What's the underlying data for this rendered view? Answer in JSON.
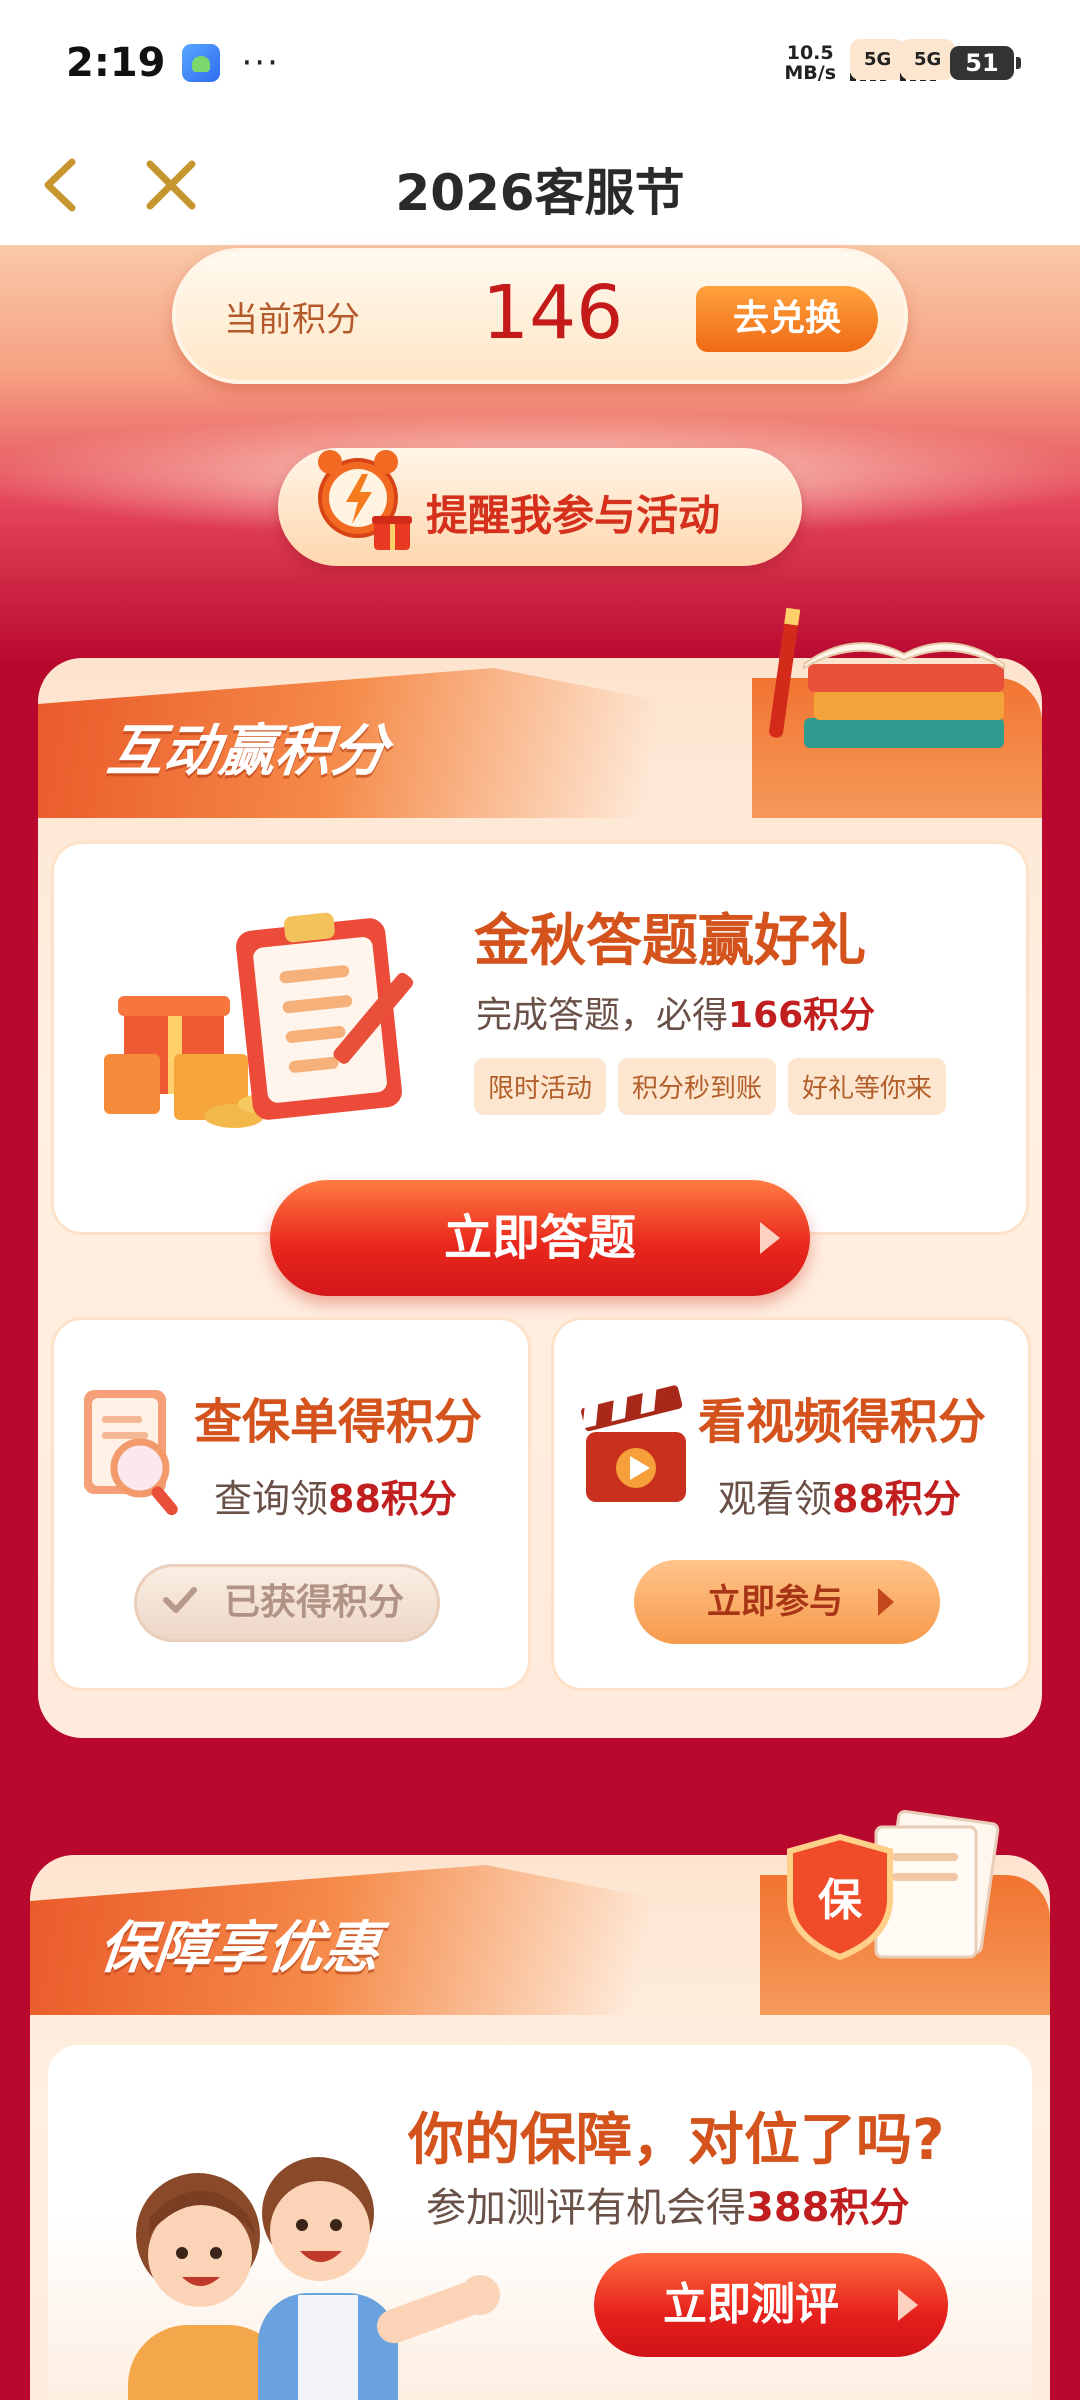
{
  "status_bar": {
    "time": "2:19",
    "more": "···",
    "speed_value": "10.5",
    "speed_unit": "MB/s",
    "network_1": "5G",
    "network_2": "5G",
    "battery": "51"
  },
  "nav": {
    "title": "2026客服节"
  },
  "points": {
    "label": "当前积分",
    "value": "146",
    "exchange_label": "去兑换"
  },
  "remind": {
    "label": "提醒我参与活动"
  },
  "section_interact": {
    "title": "互动赢积分",
    "quiz": {
      "title": "金秋答题赢好礼",
      "desc_prefix": "完成答题，必得",
      "desc_highlight": "166积分",
      "tags": [
        "限时活动",
        "积分秒到账",
        "好礼等你来"
      ],
      "button": "立即答题"
    },
    "policy": {
      "title": "查保单得积分",
      "desc_prefix": "查询领",
      "desc_highlight": "88积分",
      "button": "已获得积分"
    },
    "video": {
      "title": "看视频得积分",
      "desc_prefix": "观看领",
      "desc_highlight": "88积分",
      "button": "立即参与"
    }
  },
  "section_protect": {
    "title": "保障享优惠",
    "shield_text": "保",
    "eval": {
      "title": "你的保障，对位了吗?",
      "desc_prefix": "参加测评有机会得",
      "desc_highlight": "388积分",
      "button": "立即测评"
    }
  },
  "colors": {
    "page_red": "#b8082e",
    "accent_orange": "#d4521c",
    "highlight_red": "#c11f1f"
  }
}
